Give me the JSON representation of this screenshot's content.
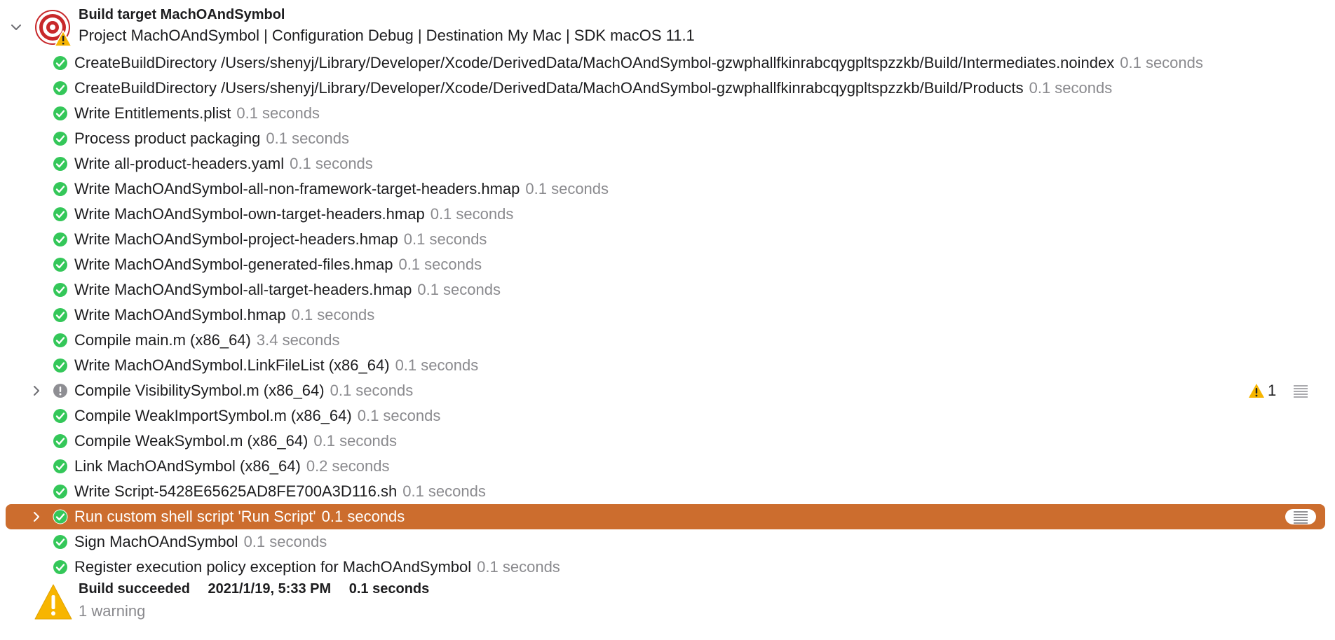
{
  "header": {
    "title": "Build target MachOAndSymbol",
    "subtitle": "Project MachOAndSymbol | Configuration Debug | Destination My Mac | SDK macOS 11.1"
  },
  "rows": [
    {
      "text": "CreateBuildDirectory /Users/shenyj/Library/Developer/Xcode/DerivedData/MachOAndSymbol-gzwphallfkinrabcqygpltspzzkb/Build/Intermediates.noindex",
      "duration": "0.1 seconds",
      "status": "success"
    },
    {
      "text": "CreateBuildDirectory /Users/shenyj/Library/Developer/Xcode/DerivedData/MachOAndSymbol-gzwphallfkinrabcqygpltspzzkb/Build/Products",
      "duration": "0.1 seconds",
      "status": "success"
    },
    {
      "text": "Write Entitlements.plist",
      "duration": "0.1 seconds",
      "status": "success"
    },
    {
      "text": "Process product packaging",
      "duration": "0.1 seconds",
      "status": "success"
    },
    {
      "text": "Write all-product-headers.yaml",
      "duration": "0.1 seconds",
      "status": "success"
    },
    {
      "text": "Write MachOAndSymbol-all-non-framework-target-headers.hmap",
      "duration": "0.1 seconds",
      "status": "success"
    },
    {
      "text": "Write MachOAndSymbol-own-target-headers.hmap",
      "duration": "0.1 seconds",
      "status": "success"
    },
    {
      "text": "Write MachOAndSymbol-project-headers.hmap",
      "duration": "0.1 seconds",
      "status": "success"
    },
    {
      "text": "Write MachOAndSymbol-generated-files.hmap",
      "duration": "0.1 seconds",
      "status": "success"
    },
    {
      "text": "Write MachOAndSymbol-all-target-headers.hmap",
      "duration": "0.1 seconds",
      "status": "success"
    },
    {
      "text": "Write MachOAndSymbol.hmap",
      "duration": "0.1 seconds",
      "status": "success"
    },
    {
      "text": "Compile main.m (x86_64)",
      "duration": "3.4 seconds",
      "status": "success"
    },
    {
      "text": "Write MachOAndSymbol.LinkFileList (x86_64)",
      "duration": "0.1 seconds",
      "status": "success"
    },
    {
      "text": "Compile VisibilitySymbol.m (x86_64)",
      "duration": "0.1 seconds",
      "status": "warning",
      "warning_count": "1"
    },
    {
      "text": "Compile WeakImportSymbol.m (x86_64)",
      "duration": "0.1 seconds",
      "status": "success"
    },
    {
      "text": "Compile WeakSymbol.m (x86_64)",
      "duration": "0.1 seconds",
      "status": "success"
    },
    {
      "text": "Link MachOAndSymbol (x86_64)",
      "duration": "0.2 seconds",
      "status": "success"
    },
    {
      "text": "Write Script-5428E65625AD8FE700A3D116.sh",
      "duration": "0.1 seconds",
      "status": "success"
    },
    {
      "text": "Run custom shell script 'Run Script'",
      "duration": "0.1 seconds",
      "status": "success",
      "selected": true
    },
    {
      "text": "Sign MachOAndSymbol",
      "duration": "0.1 seconds",
      "status": "success"
    },
    {
      "text": "Register execution policy exception for MachOAndSymbol",
      "duration": "0.1 seconds",
      "status": "success"
    }
  ],
  "footer": {
    "status": "Build succeeded",
    "timestamp": "2021/1/19, 5:33 PM",
    "duration": "0.1 seconds",
    "warnings": "1 warning"
  },
  "colors": {
    "success": "#34c759",
    "warning": "#f7b500",
    "selection": "#cc6d2e",
    "secondary_text": "#8a8a8e",
    "target_red": "#c8282a"
  },
  "icons": {
    "success": "checkmark-circle-icon",
    "warning_row": "exclamation-circle-icon",
    "warning_badge": "warning-triangle-icon",
    "log": "log-list-icon",
    "target": "target-icon",
    "disclosure": "chevron-icon"
  }
}
